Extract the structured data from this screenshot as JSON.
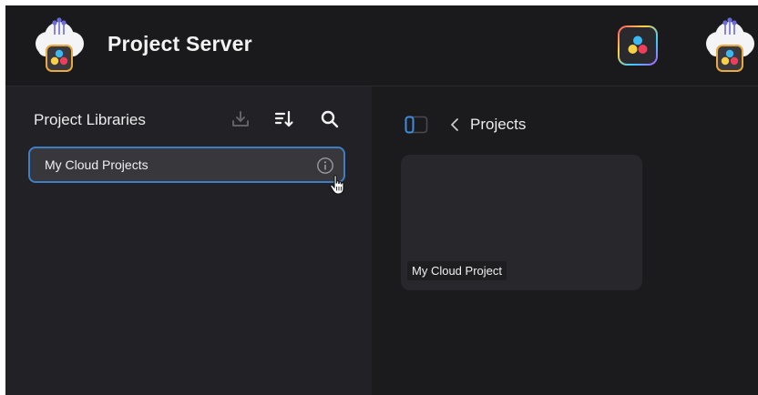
{
  "header": {
    "title": "Project Server",
    "app_logo_icon": "cloud-resolve-logo",
    "resolve_button_icon": "davinci-resolve-icon",
    "cloud_button_icon": "cloud-resolve-logo"
  },
  "libraries": {
    "title": "Project Libraries",
    "toolbar": {
      "import_icon": "import-icon",
      "sort_icon": "sort-icon",
      "search_icon": "search-icon"
    },
    "items": [
      {
        "label": "My Cloud Projects",
        "selected": true,
        "info_icon": "info-icon"
      }
    ]
  },
  "projects": {
    "breadcrumb": "Projects",
    "items": [
      {
        "name": "My Cloud Project"
      }
    ]
  },
  "colors": {
    "accent": "#3d7fc4",
    "background": "#1e1d1f"
  }
}
